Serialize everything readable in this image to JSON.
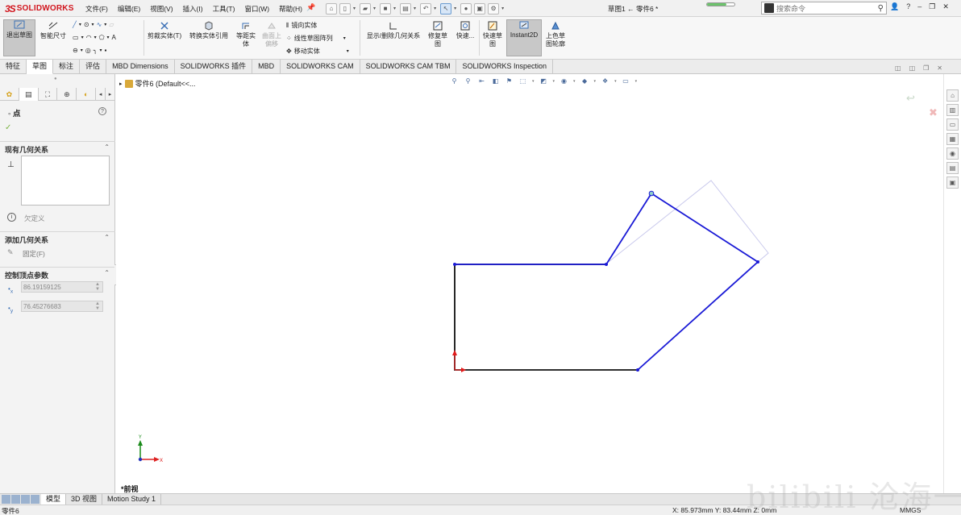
{
  "app": {
    "logo_text": "SOLIDWORKS",
    "document_title": "草图1 ← 零件6 *",
    "menu": [
      "文件(F)",
      "编辑(E)",
      "视图(V)",
      "插入(I)",
      "工具(T)",
      "窗口(W)",
      "帮助(H)"
    ],
    "search_placeholder": "搜索命令",
    "progress_fraction": 0.7
  },
  "commands": {
    "exit_sketch": "退出草图",
    "smart_dim": "智能尺寸",
    "trim": "剪裁实体(T)",
    "convert": "转换实体引用",
    "offset_1": "等距实",
    "offset_2": "体",
    "surface_1": "曲面上",
    "surface_2": "偏移",
    "mirror": "镜向实体",
    "linear_pattern": "线性草图阵列",
    "move": "移动实体",
    "show_relations": "显示/删除几何关系",
    "repair_1": "修复草",
    "repair_2": "图",
    "quick_snap": "快速...",
    "rapid_1": "快速草",
    "rapid_2": "图",
    "instant2d": "Instant2D",
    "shaded_1": "上色草",
    "shaded_2": "图轮廓"
  },
  "tabs": [
    "特征",
    "草图",
    "标注",
    "评估",
    "MBD Dimensions",
    "SOLIDWORKS 插件",
    "MBD",
    "SOLIDWORKS CAM",
    "SOLIDWORKS CAM TBM",
    "SOLIDWORKS Inspection"
  ],
  "selected_tab": "草图",
  "property_manager": {
    "title": "点",
    "section_existing": "现有几何关系",
    "status": "欠定义",
    "section_add": "添加几何关系",
    "fix": "固定(F)",
    "section_params": "控制顶点参数",
    "x_value": "86.19159125",
    "y_value": "76.45276683",
    "x_sub": "x",
    "y_sub": "y"
  },
  "canvas": {
    "tree_node": "零件6  (Default<<...",
    "view_label": "*前视"
  },
  "bottom_tabs": [
    "模型",
    "3D 视图",
    "Motion Study 1"
  ],
  "selected_bottom_tab": "模型",
  "status": {
    "left": "零件6",
    "coords": "X: 85.973mm Y: 83.44mm Z: 0mm",
    "units": "MMGS"
  },
  "watermark": "bilibili 沧海一笑"
}
